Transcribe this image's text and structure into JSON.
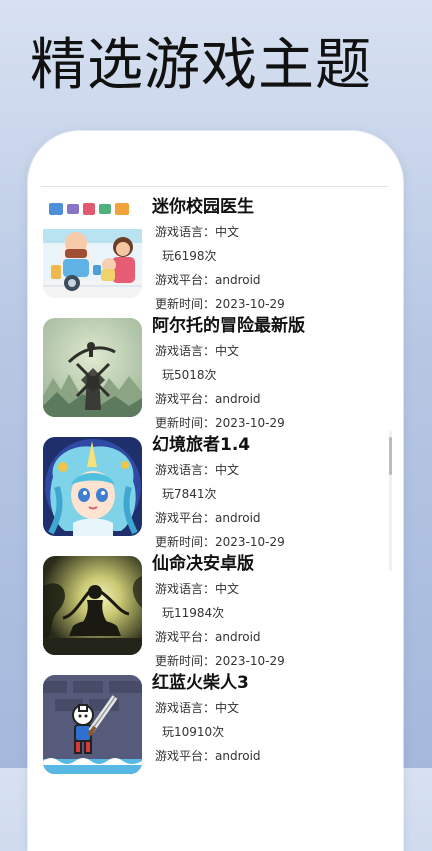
{
  "page": {
    "headline": "精选游戏主题"
  },
  "games": [
    {
      "name": "迷你校园医生",
      "language": "游戏语言：中文",
      "plays": "玩6198次",
      "platform": "游戏平台：android",
      "updated": "更新时间：2023-10-29"
    },
    {
      "name": "阿尔托的冒险最新版",
      "language": "游戏语言：中文",
      "plays": "玩5018次",
      "platform": "游戏平台：android",
      "updated": "更新时间：2023-10-29"
    },
    {
      "name": "幻境旅者1.4",
      "language": "游戏语言：中文",
      "plays": "玩7841次",
      "platform": "游戏平台：android",
      "updated": "更新时间：2023-10-29"
    },
    {
      "name": "仙命决安卓版",
      "language": "游戏语言：中文",
      "plays": "玩11984次",
      "platform": "游戏平台：android",
      "updated": "更新时间：2023-10-29"
    },
    {
      "name": "红蓝火柴人3",
      "language": "游戏语言：中文",
      "plays": "玩10910次",
      "platform": "游戏平台：android"
    }
  ],
  "colors": {
    "background_top": "#d7e1f1",
    "background_bottom": "#a5b8dc",
    "card": "#ffffff",
    "title_text": "#111111",
    "meta_text": "#333333"
  }
}
